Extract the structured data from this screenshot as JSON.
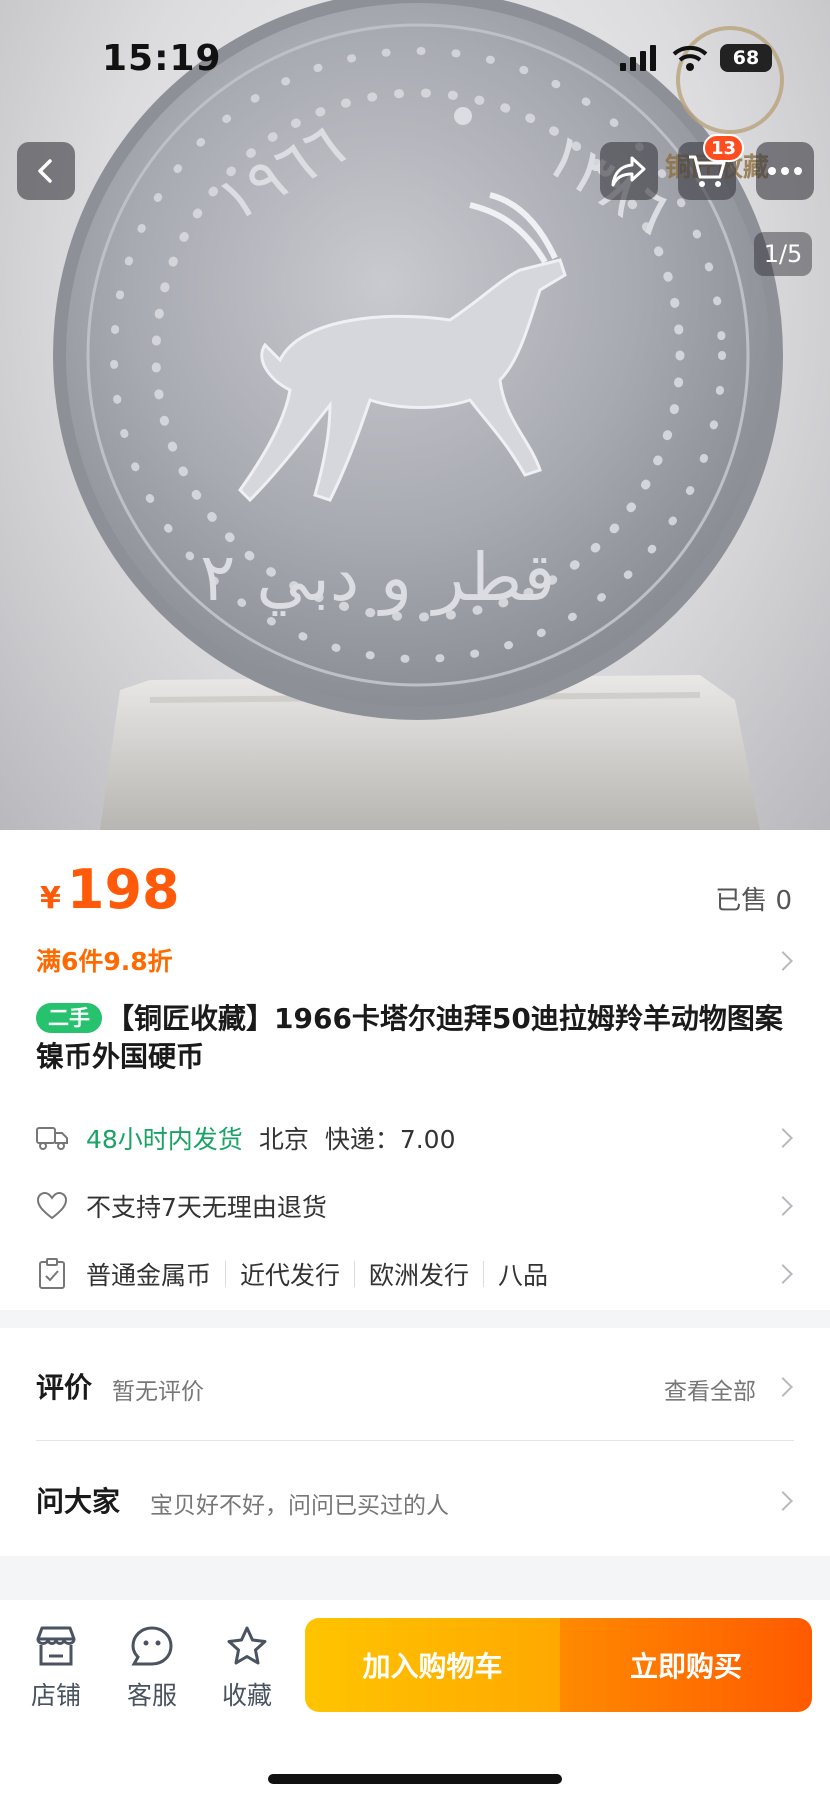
{
  "status": {
    "time": "15:19",
    "battery": "68"
  },
  "nav": {
    "cart_count": "13",
    "image_counter": "1/5"
  },
  "hero": {
    "year_left": "١٩٦٦",
    "year_right": "١٣٨٦",
    "bottom_text": "قطر و دبي ٢",
    "watermark": "铜匠收藏"
  },
  "product": {
    "currency": "¥",
    "price": "198",
    "sold": "已售 0",
    "promo": "满6件9.8折",
    "used_tag": "二手",
    "title": "【铜匠收藏】1966卡塔尔迪拜50迪拉姆羚羊动物图案镍币外国硬币"
  },
  "shipping": {
    "speed": "48小时内发货",
    "origin": "北京",
    "fee": "快递：7.00"
  },
  "returns": {
    "policy": "不支持7天无理由退货"
  },
  "attributes": [
    "普通金属币",
    "近代发行",
    "欧洲发行",
    "八品"
  ],
  "reviews": {
    "title": "评价",
    "subtitle": "暂无评价",
    "link": "查看全部"
  },
  "qa": {
    "title": "问大家",
    "subtitle": "宝贝好不好，问问已买过的人"
  },
  "bottom_bar": {
    "shop": "店铺",
    "service": "客服",
    "favorite": "收藏",
    "add_to_cart": "加入购物车",
    "buy_now": "立即购买"
  },
  "colors": {
    "price": "#ff5a0a",
    "green": "#1aa364",
    "cart_btn": "#ffb400",
    "buy_btn": "#ff6a00"
  }
}
